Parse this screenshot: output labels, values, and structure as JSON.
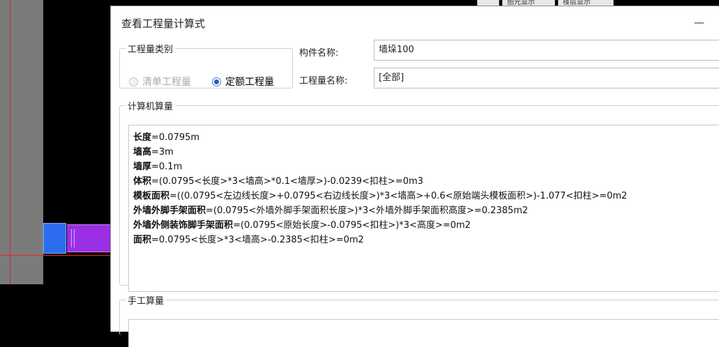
{
  "background": {
    "top_tabs": [
      "",
      "图元显示",
      "楼层显示"
    ]
  },
  "dialog": {
    "title": "查看工程量计算式",
    "minimize_glyph": "—",
    "qty_type": {
      "legend": "工程量类别",
      "options": [
        {
          "label": "清单工程量",
          "checked": false,
          "enabled": false
        },
        {
          "label": "定额工程量",
          "checked": true,
          "enabled": true
        }
      ]
    },
    "component_name": {
      "label": "构件名称:",
      "value": "墙垛100"
    },
    "quantity_name": {
      "label": "工程量名称:",
      "value": "[全部]"
    },
    "computer": {
      "legend": "计算机算量",
      "lines": [
        {
          "name": "长度",
          "expr": "=0.0795m"
        },
        {
          "name": "墙高",
          "expr": "=3m"
        },
        {
          "name": "墙厚",
          "expr": "=0.1m"
        },
        {
          "name": "体积",
          "expr": "=(0.0795<长度>*3<墙高>*0.1<墙厚>)-0.0239<扣柱>=0m3"
        },
        {
          "name": "模板面积",
          "expr": "=((0.0795<左边线长度>+0.0795<右边线长度>)*3<墙高>+0.6<原始端头模板面积>)-1.077<扣柱>=0m2"
        },
        {
          "name": "外墙外脚手架面积",
          "expr": "=(0.0795<外墙外脚手架面积长度>)*3<外墙外脚手架面积高度>=0.2385m2"
        },
        {
          "name": "外墙外侧装饰脚手架面积",
          "expr": "=(0.0795<原始长度>-0.0795<扣柱>)*3<高度>=0m2"
        },
        {
          "name": "面积",
          "expr": "=0.0795<长度>*3<墙高>-0.2385<扣柱>=0m2"
        }
      ]
    },
    "manual": {
      "legend": "手工算量"
    }
  },
  "colors": {
    "accent": "#1f5fbf",
    "cad_blue": "#2c6df0",
    "cad_purple": "#9a2fe6",
    "cad_red": "#ff2020"
  }
}
